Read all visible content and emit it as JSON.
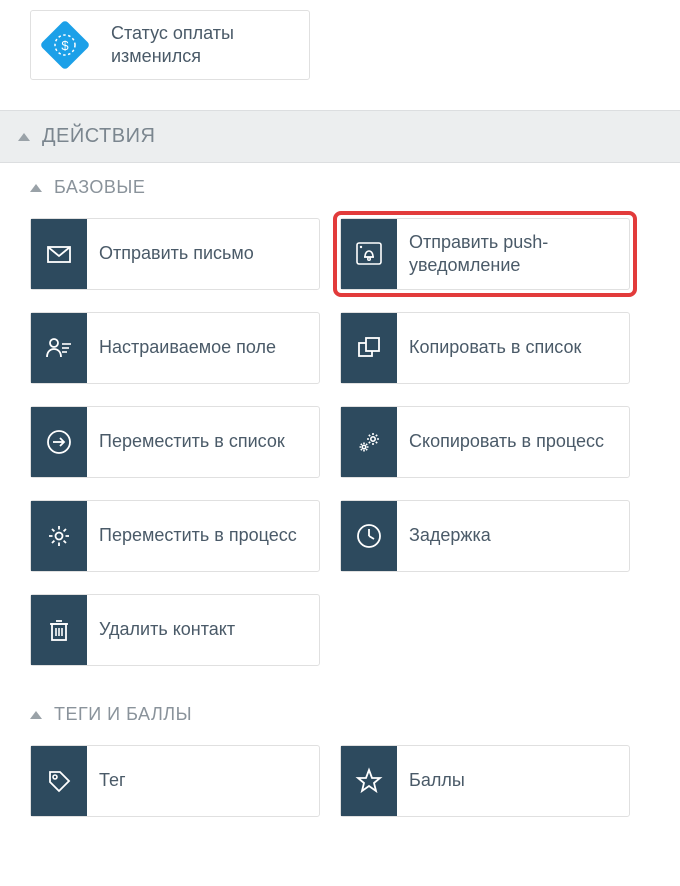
{
  "trigger": {
    "payment_status_changed": "Статус оплаты изменился"
  },
  "sections": {
    "actions": "ДЕЙСТВИЯ",
    "basic": "БАЗОВЫЕ",
    "tags_and_points": "ТЕГИ И БАЛЛЫ"
  },
  "actions": {
    "send_email": "Отправить письмо",
    "send_push": "Отправить push-уведомление",
    "custom_field": "Настраиваемое поле",
    "copy_to_list": "Копировать в список",
    "move_to_list": "Переместить в список",
    "copy_to_process": "Скопировать в процесс",
    "move_to_process": "Переместить в процесс",
    "delay": "Задержка",
    "delete_contact": "Удалить контакт",
    "tag": "Тег",
    "points": "Баллы"
  },
  "colors": {
    "icon_bg": "#2d4a5e",
    "trigger_bg": "#1ca0e8",
    "highlight": "#e23b3b"
  }
}
